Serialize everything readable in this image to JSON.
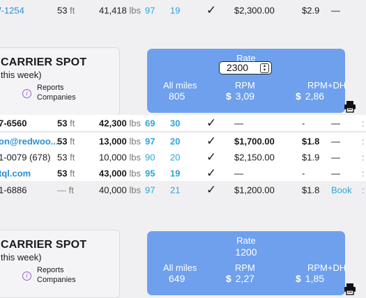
{
  "top_row": {
    "contact": "/-1254",
    "length": "53",
    "length_unit": "ft",
    "weight": "41,418",
    "weight_unit": "lbs",
    "num_a": "97",
    "num_b": "19",
    "check": "✓",
    "rate": "$2,300.00",
    "rpm": "$2.9",
    "dash": "—"
  },
  "carrier_spot": {
    "title": "CARRIER SPOT",
    "subtitle": "this week)",
    "reports_line1": "Reports",
    "reports_line2": "Companies",
    "info_icon": "info-icon"
  },
  "rate_card_1": {
    "rate_label": "Rate",
    "rate_input_value": "2300",
    "all_miles_label": "All miles",
    "all_miles_value": "805",
    "rpm_label": "RPM",
    "rpm_value": "3,09",
    "rpm_dh_label": "RPM+DH",
    "rpm_dh_value": "2,86",
    "currency": "$"
  },
  "loads": [
    {
      "contact": "7-6560",
      "length": "53",
      "length_unit": "ft",
      "weight": "42,300",
      "weight_unit": "lbs",
      "num_a": "69",
      "num_b": "30",
      "check": "✓",
      "rate": "—",
      "rpm": "-",
      "end": "—",
      "edge": ""
    },
    {
      "contact": "on@redwoo...",
      "length": "53",
      "length_unit": "ft",
      "weight": "13,000",
      "weight_unit": "lbs",
      "num_a": "97",
      "num_b": "20",
      "check": "✓",
      "rate": "$1,700.00",
      "rpm": "$1.8",
      "end": "—",
      "edge": ""
    },
    {
      "contact": "1-0079 (678)",
      "length": "53",
      "length_unit": "ft",
      "weight": "10,000",
      "weight_unit": "lbs",
      "num_a": "90",
      "num_b": "20",
      "check": "✓",
      "rate": "$2,150.00",
      "rpm": "$1.9",
      "end": "—",
      "edge": ""
    },
    {
      "contact": "tql.com",
      "length": "53",
      "length_unit": "ft",
      "weight": "43,000",
      "weight_unit": "lbs",
      "num_a": "95",
      "num_b": "19",
      "check": "✓",
      "rate": "—",
      "rpm": "-",
      "end": "—",
      "edge": ""
    },
    {
      "contact": "1-6886",
      "length": "—",
      "length_unit": "ft",
      "weight": "40,000",
      "weight_unit": "lbs",
      "num_a": "97",
      "num_b": "21",
      "check": "✓",
      "rate": "$1,200.00",
      "rpm": "$1.8",
      "end": "Book",
      "edge": ""
    }
  ],
  "rate_card_2": {
    "rate_label": "Rate",
    "rate_value": "1200",
    "all_miles_label": "All miles",
    "all_miles_value": "649",
    "rpm_label": "RPM",
    "rpm_value": "2,27",
    "rpm_dh_label": "RPM+DH",
    "rpm_dh_value": "1,85",
    "currency": "$"
  },
  "icons": {
    "printer": "printer-icon",
    "check": "checkmark-icon",
    "info": "info-icon"
  },
  "colors": {
    "accent_blue": "#2aa6e0",
    "card_blue": "#6ea0ee",
    "info_purple": "#9b59d0"
  }
}
